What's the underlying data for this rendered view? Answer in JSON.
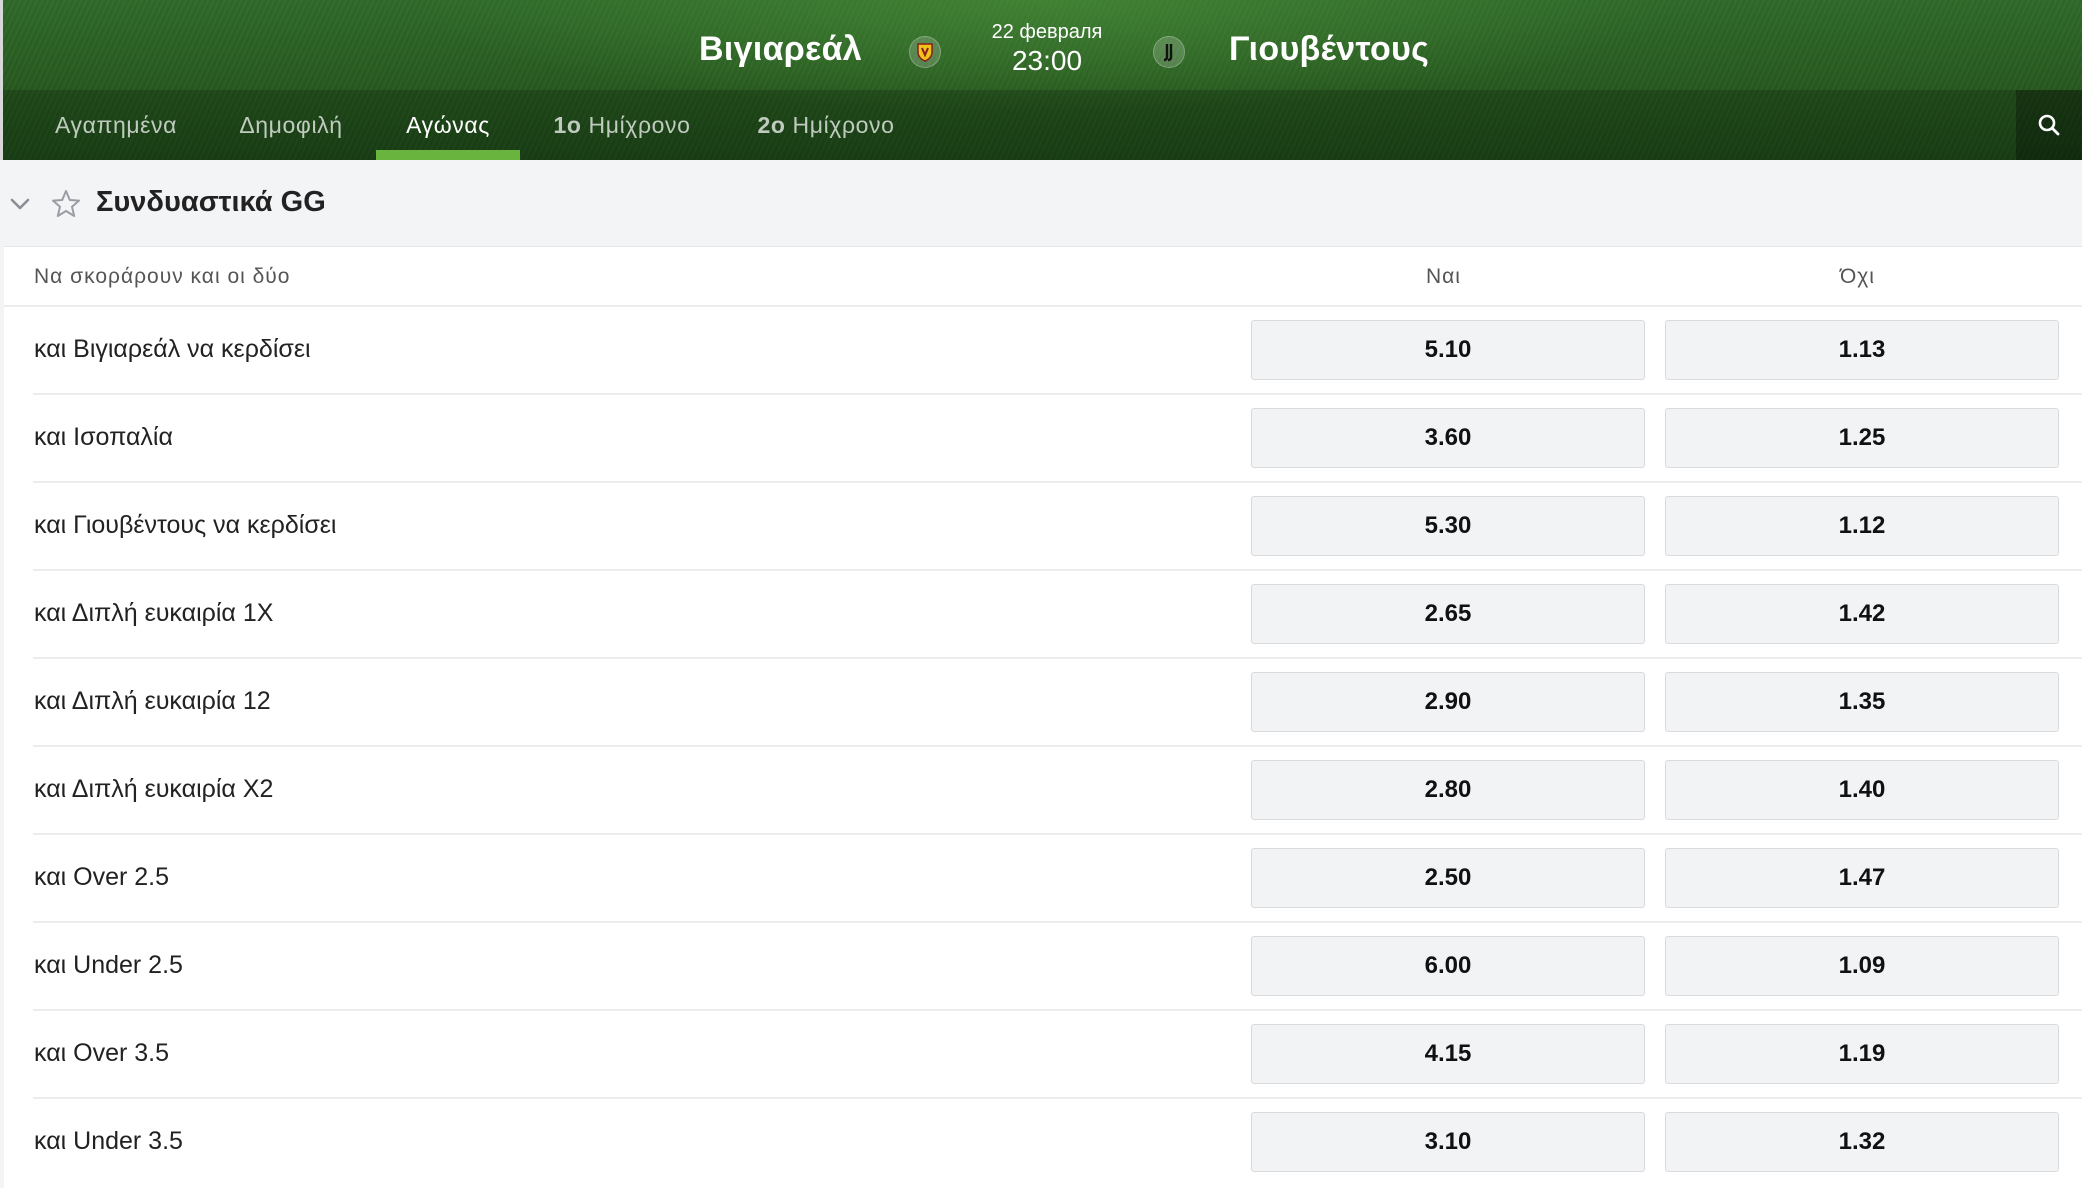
{
  "match": {
    "home_team": "Βιγιαρεάλ",
    "away_team": "Γιουβέντους",
    "date": "22 февраля",
    "time": "23:00"
  },
  "tabs": [
    {
      "label": "Αγαπημένα",
      "active": false
    },
    {
      "label": "Δημοφιλή",
      "active": false
    },
    {
      "label": "Αγώνας",
      "active": true
    },
    {
      "label_bold": "1ο",
      "label": " Ημίχρονο",
      "active": false
    },
    {
      "label_bold": "2ο",
      "label": " Ημίχρονο",
      "active": false
    }
  ],
  "icons": {
    "search": "search-icon",
    "collapse": "chevron-down-icon",
    "favorite": "star-icon",
    "home_crest": "villarreal-crest-icon",
    "away_crest": "juventus-crest-icon"
  },
  "colors": {
    "accent": "#68b43f",
    "header_green": "#27591f",
    "odd_bg": "#f2f3f5"
  },
  "market": {
    "title": "Συνδυαστικά GG",
    "column_label": "Να σκοράρουν και οι δύο",
    "yes_header": "Ναι",
    "no_header": "Όχι",
    "rows": [
      {
        "label": "και Βιγιαρεάλ να κερδίσει",
        "yes": "5.10",
        "no": "1.13"
      },
      {
        "label": "και Ισοπαλία",
        "yes": "3.60",
        "no": "1.25"
      },
      {
        "label": "και Γιουβέντους να κερδίσει",
        "yes": "5.30",
        "no": "1.12"
      },
      {
        "label": "και Διπλή ευκαιρία 1X",
        "yes": "2.65",
        "no": "1.42"
      },
      {
        "label": "και Διπλή ευκαιρία 12",
        "yes": "2.90",
        "no": "1.35"
      },
      {
        "label": "και Διπλή ευκαιρία X2",
        "yes": "2.80",
        "no": "1.40"
      },
      {
        "label": "και Over 2.5",
        "yes": "2.50",
        "no": "1.47"
      },
      {
        "label": "και Under 2.5",
        "yes": "6.00",
        "no": "1.09"
      },
      {
        "label": "και Over 3.5",
        "yes": "4.15",
        "no": "1.19"
      },
      {
        "label": "και Under 3.5",
        "yes": "3.10",
        "no": "1.32"
      }
    ]
  }
}
